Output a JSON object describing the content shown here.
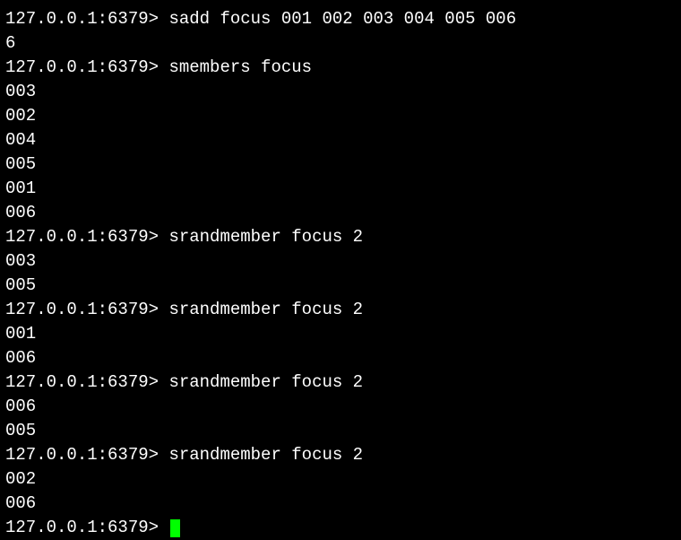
{
  "prompt": "127.0.0.1:6379> ",
  "entries": [
    {
      "cmd": "sadd focus 001 002 003 004 005 006",
      "out": [
        "6"
      ]
    },
    {
      "cmd": "smembers focus",
      "out": [
        "003",
        "002",
        "004",
        "005",
        "001",
        "006"
      ]
    },
    {
      "cmd": "srandmember focus 2",
      "out": [
        "003",
        "005"
      ]
    },
    {
      "cmd": "srandmember focus 2",
      "out": [
        "001",
        "006"
      ]
    },
    {
      "cmd": "srandmember focus 2",
      "out": [
        "006",
        "005"
      ]
    },
    {
      "cmd": "srandmember focus 2",
      "out": [
        "002",
        "006"
      ]
    }
  ]
}
